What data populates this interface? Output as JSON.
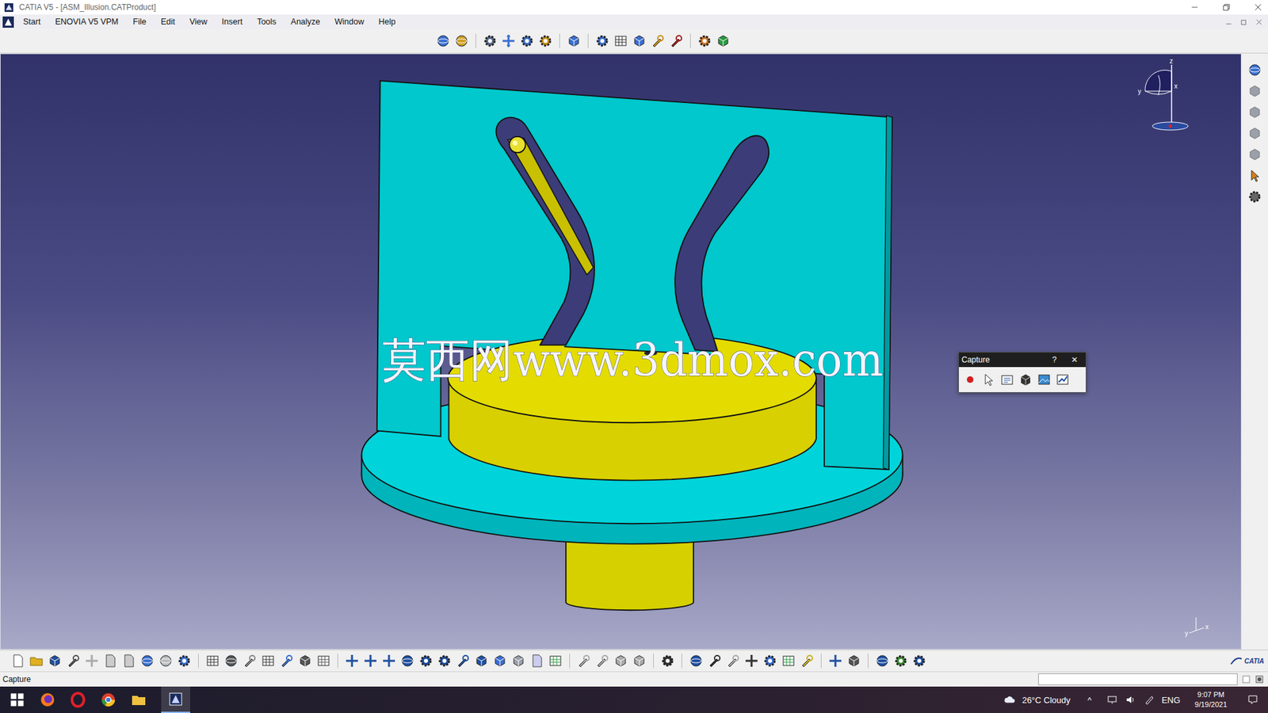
{
  "window": {
    "title": "CATIA V5 - [ASM_Illusion.CATProduct]"
  },
  "menu": [
    {
      "label": "Start"
    },
    {
      "label": "ENOVIA V5 VPM"
    },
    {
      "label": "File"
    },
    {
      "label": "Edit"
    },
    {
      "label": "View"
    },
    {
      "label": "Insert"
    },
    {
      "label": "Tools"
    },
    {
      "label": "Analyze"
    },
    {
      "label": "Window"
    },
    {
      "label": "Help"
    }
  ],
  "viewport": {
    "watermark": "莫西网www.3dmox.com",
    "compass_axes": {
      "z": "z",
      "x": "x",
      "y": "y"
    },
    "triad_axes": {
      "y": "y",
      "x": "x"
    }
  },
  "capture_dialog": {
    "title": "Capture",
    "help": "?",
    "close": "✕"
  },
  "status_bar": {
    "text": "Capture"
  },
  "brand": "CATIA",
  "taskbar": {
    "weather": "26°C Cloudy",
    "chevron": "^",
    "language": "ENG",
    "time": "9:07 PM",
    "date": "9/19/2021"
  }
}
